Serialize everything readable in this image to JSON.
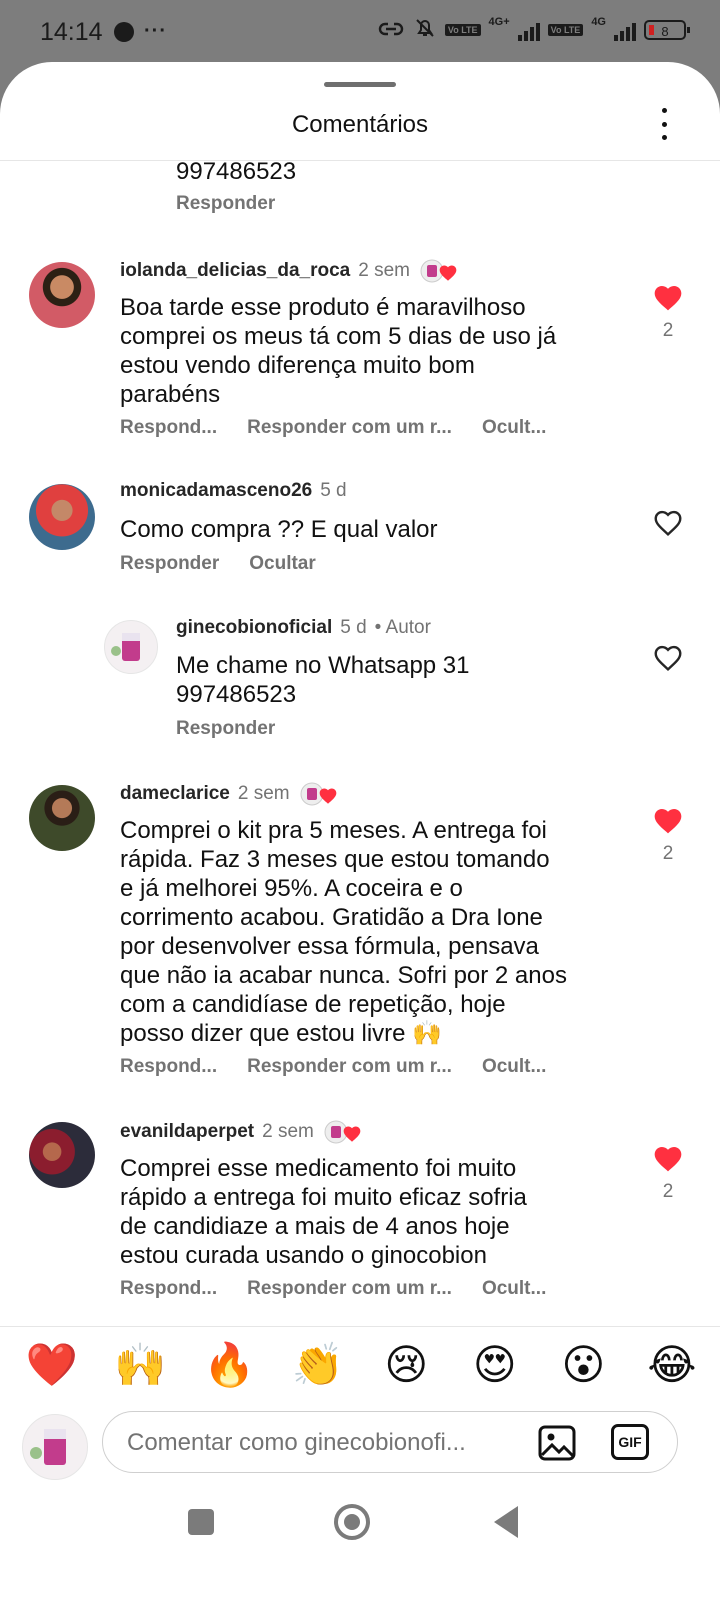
{
  "status_bar": {
    "time": "14:14",
    "left_icons": [
      "tw-icon",
      "more-dots"
    ],
    "battery": "8",
    "network_1": "4G+",
    "network_2": "4G",
    "volte": "Vo LTE"
  },
  "header": {
    "title": "Comentários",
    "handle_icon": "drag-handle",
    "more_icon": "more-vertical-icon"
  },
  "partial_comment": {
    "text": "997486523",
    "reply": "Responder"
  },
  "comments": [
    {
      "user": "iolanda_delicias_da_roca",
      "time": "2 sem",
      "author_liked": true,
      "text_lines": [
        "Boa tarde esse produto é maravilhoso",
        "comprei os meus tá com 5 dias de uso já",
        "estou vendo diferença muito bom",
        "parabéns"
      ],
      "actions": [
        "Respond...",
        "Responder com um r...",
        "Ocult..."
      ],
      "liked": true,
      "like_count": "2"
    },
    {
      "user": "monicadamasceno26",
      "time": "5 d",
      "author_liked": false,
      "text_lines": [
        "Como compra ?? E qual valor"
      ],
      "actions": [
        "Responder",
        "Ocultar"
      ],
      "liked": false,
      "like_count": ""
    },
    {
      "user": "ginecobionoficial",
      "time": "5 d",
      "author_label": "• Autor",
      "text_lines": [
        "Me chame no Whatsapp 31",
        "997486523"
      ],
      "actions": [
        "Responder"
      ],
      "liked": false,
      "like_count": "",
      "is_reply": true
    },
    {
      "user": "dameclarice",
      "time": "2 sem",
      "author_liked": true,
      "text_lines": [
        "Comprei o kit pra 5 meses.  A entrega foi",
        "rápida. Faz 3 meses que estou tomando",
        "e já melhorei 95%. A coceira e o",
        "corrimento acabou. Gratidão a Dra Ione",
        "por desenvolver essa fórmula, pensava",
        "que não ia acabar nunca. Sofri por 2 anos",
        "com a candidíase de repetição, hoje",
        "posso dizer que estou livre 🙌"
      ],
      "actions": [
        "Respond...",
        "Responder com um r...",
        "Ocult..."
      ],
      "liked": true,
      "like_count": "2"
    },
    {
      "user": "evanildaperpet",
      "time": "2 sem",
      "author_liked": true,
      "text_lines": [
        "Comprei esse medicamento foi muito",
        "rápido  a entrega foi muito eficaz  sofria",
        "de candidiaze  a mais de 4 anos hoje",
        "estou curada  usando o ginocobion"
      ],
      "actions": [
        "Respond...",
        "Responder com um r...",
        "Ocult..."
      ],
      "liked": true,
      "like_count": "2"
    }
  ],
  "emoji_bar": [
    "❤️",
    "🙌",
    "🔥",
    "👏",
    "😢",
    "😍",
    "😮",
    "😂"
  ],
  "composer": {
    "placeholder": "Comentar como ginecobionofi...",
    "image_icon": "image-icon",
    "gif_label": "GIF"
  },
  "nav_bar": [
    "recents-square-icon",
    "home-circle-icon",
    "back-triangle-icon"
  ],
  "colors": {
    "like_red": "#ff3040",
    "meta_gray": "#737373",
    "status_bg": "#7d7d7d"
  }
}
